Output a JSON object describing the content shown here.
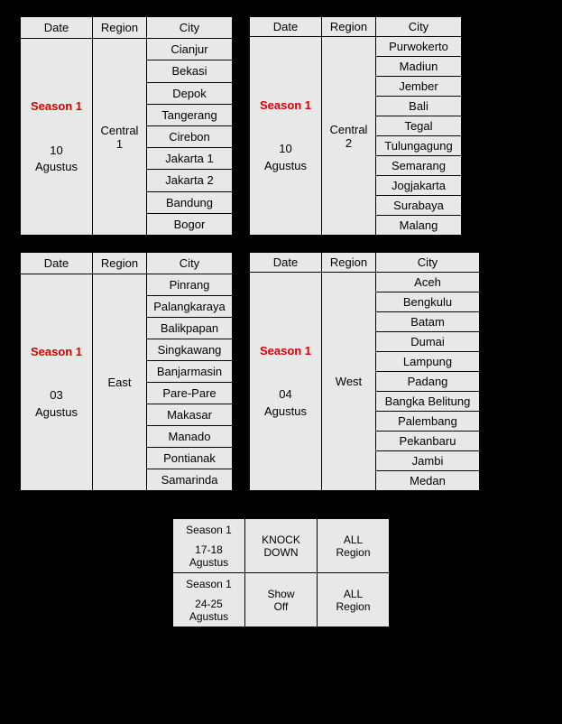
{
  "headers": {
    "date": "Date",
    "region": "Region",
    "city": "City"
  },
  "tables": [
    {
      "season": "Season 1",
      "date": "10 Agustus",
      "region": "Central 1",
      "cities": [
        "Cianjur",
        "Bekasi",
        "Depok",
        "Tangerang",
        "Cirebon",
        "Jakarta 1",
        "Jakarta 2",
        "Bandung",
        "Bogor"
      ],
      "wide": false
    },
    {
      "season": "Season 1",
      "date": "10 Agustus",
      "region": "Central 2",
      "cities": [
        "Purwokerto",
        "Madiun",
        "Jember",
        "Bali",
        "Tegal",
        "Tulungagung",
        "Semarang",
        "Jogjakarta",
        "Surabaya",
        "Malang"
      ],
      "wide": false
    },
    {
      "season": "Season 1",
      "date": "03 Agustus",
      "region": "East",
      "cities": [
        "Pinrang",
        "Palangkaraya",
        "Balikpapan",
        "Singkawang",
        "Banjarmasin",
        "Pare-Pare",
        "Makasar",
        "Manado",
        "Pontianak",
        "Samarinda"
      ],
      "wide": false
    },
    {
      "season": "Season 1",
      "date": "04 Agustus",
      "region": "West",
      "cities": [
        "Aceh",
        "Bengkulu",
        "Batam",
        "Dumai",
        "Lampung",
        "Padang",
        "Bangka Belitung",
        "Palembang",
        "Pekanbaru",
        "Jambi",
        "Medan"
      ],
      "wide": true
    }
  ],
  "bottom": [
    {
      "season": "Season 1",
      "date": "17-18 Agustus",
      "stage": "KNOCK DOWN",
      "region": "ALL Region"
    },
    {
      "season": "Season 1",
      "date": "24-25 Agustus",
      "stage": "Show Off",
      "region": "ALL Region"
    }
  ]
}
